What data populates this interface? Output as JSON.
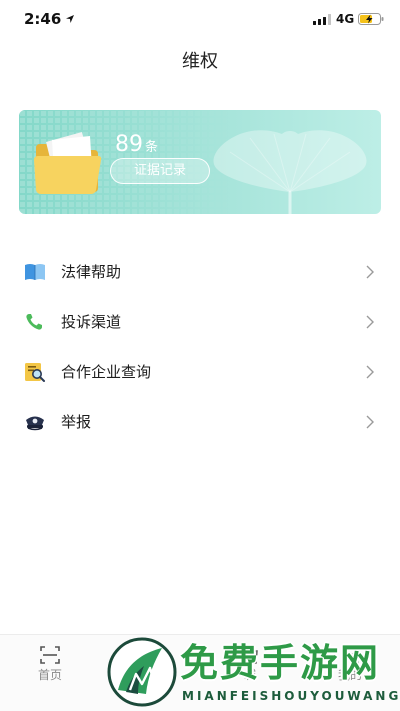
{
  "status_bar": {
    "time": "2:46",
    "network": "4G",
    "icons": [
      "location-arrow-icon",
      "signal-icon",
      "battery-charging-icon"
    ]
  },
  "header": {
    "title": "维权"
  },
  "banner": {
    "count": "89",
    "count_unit": "条",
    "button_label": "证据记录",
    "icons": [
      "folder-icon",
      "ginkgo-leaf-icon"
    ],
    "colors": {
      "gradient_start": "#84d8c9",
      "gradient_end": "#bdeee6",
      "text": "#ffffff"
    }
  },
  "menu": {
    "items": [
      {
        "label": "法律帮助",
        "icon": "book-icon"
      },
      {
        "label": "投诉渠道",
        "icon": "phone-icon"
      },
      {
        "label": "合作企业查询",
        "icon": "search-document-icon"
      },
      {
        "label": "举报",
        "icon": "police-cap-icon"
      }
    ]
  },
  "tab_bar": {
    "tabs": [
      {
        "label": "首页",
        "icon": "scan-icon"
      },
      {},
      {
        "label": "城",
        "icon": "mall-icon"
      },
      {
        "label": "我的",
        "icon": "user-icon"
      }
    ]
  },
  "watermark": {
    "title": "免费手游网",
    "subtitle": "MIANFEISHOUYOUWANG",
    "color": "#2e9a47"
  }
}
